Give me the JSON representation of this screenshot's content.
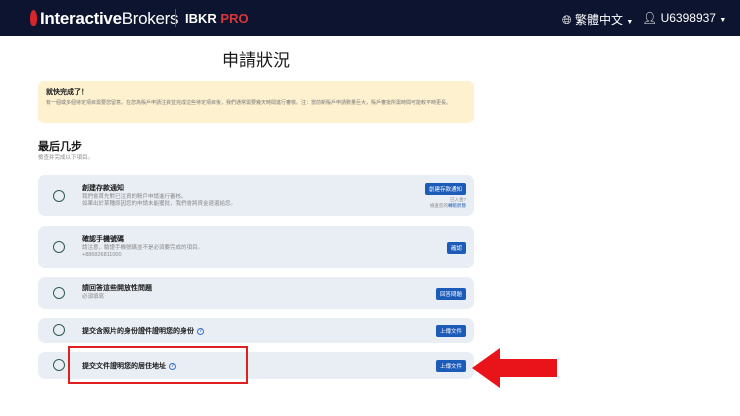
{
  "header": {
    "brand_a": "Interactive",
    "brand_b": "Brokers",
    "product": "IBKR",
    "product_accent": "PRO",
    "language": "繁體中文",
    "user": "U6398937"
  },
  "page_title": "申請狀況",
  "banner": {
    "title": "就快完成了！",
    "text": "有一個或多個待定項目需要您留意。在您為賬戶申請注資並完成這些待定項目後，我們通常需要幾天時間進行審核。注：當前新賬戶申請數量巨大，賬戶審批所需時間可能較平時更長。"
  },
  "section": {
    "title": "最后几步",
    "subtitle": "檢查并完成以下項目。"
  },
  "tasks": [
    {
      "title": "創建存款通知",
      "desc1": "我們會首先對已注資的賬戶申請進行審核。",
      "desc2": "如果出於某種原因您的申請未能獲批，我們會將資金退還給您。",
      "button": "創建存款通知",
      "note1": "已入金?",
      "note2": "檢查您的",
      "note_link": "轉賬狀態"
    },
    {
      "title": "確認手機號碼",
      "desc1": "請注意，驗證手機號碼並不是必須要完成的項目。",
      "desc2": "+886926811000",
      "button": "確認"
    },
    {
      "title": "請回答這些開放性問題",
      "desc1": "必須填寫",
      "button": "回答問題"
    },
    {
      "title": "提交含照片的身份證件證明您的身份",
      "button": "上傳文件"
    },
    {
      "title": "提交文件證明您的居住地址",
      "button": "上傳文件"
    }
  ],
  "colors": {
    "header": "#0c1430",
    "button": "#1d5bb8",
    "highlight": "#e02020"
  }
}
